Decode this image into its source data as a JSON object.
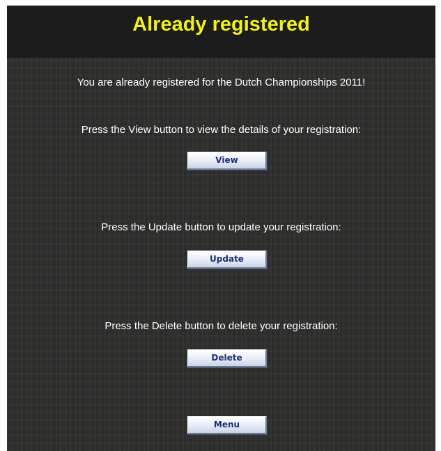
{
  "page": {
    "title": "Already registered",
    "intro": "You are already registered for the Dutch Championships 2011!",
    "view_instruction": "Press the View button to view the details of your registration:",
    "update_instruction": "Press the Update button to update your registration:",
    "delete_instruction": "Press the Delete button to delete your registration:"
  },
  "buttons": {
    "view_label": "View",
    "update_label": "Update",
    "delete_label": "Delete",
    "menu_label": "Menu"
  },
  "colors": {
    "title": "#f5f500",
    "header_background": "#1c1c1c",
    "panel_background": "#2e2e2d",
    "button_text": "#1a2f7a"
  }
}
